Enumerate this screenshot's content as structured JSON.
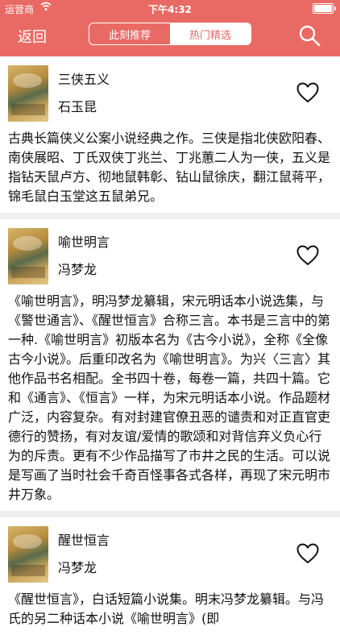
{
  "status_bar": {
    "carrier": "运营商",
    "time": "下午4:32"
  },
  "nav": {
    "back_label": "返回",
    "tabs": [
      {
        "label": "此刻推荐",
        "active": false
      },
      {
        "label": "热门精选",
        "active": true
      }
    ]
  },
  "books": [
    {
      "title": "三侠五义",
      "author": "石玉昆",
      "description": "古典长篇侠义公案小说经典之作。三侠是指北侠欧阳春、南侠展昭、丁氏双侠丁兆兰、丁兆蕙二人为一侠，五义是指钻天鼠卢方、彻地鼠韩彰、钻山鼠徐庆，翻江鼠蒋平，锦毛鼠白玉堂这五鼠弟兄。"
    },
    {
      "title": "喻世明言",
      "author": "冯梦龙",
      "description": "《喻世明言》，明冯梦龙纂辑，宋元明话本小说选集，与《警世通言》、《醒世恒言》合称三言。本书是三言中的第一种.《喻世明言》初版本名为《古今小说》，全称《全像古今小说》。后重印改名为《喻世明言》。为兴〈三言〉其他作品书名相配。全书四十卷，每卷一篇，共四十篇。它和《通言》、《恒言》一样，为宋元明话本小说。作品题材广泛，内容复杂。有对封建官僚丑恶的谴责和对正直官吏德行的赞扬，有对友谊/爱情的歌颂和对背信弃义负心行为的斥责。更有不少作品描写了市井之民的生活。可以说是写画了当时社会千奇百怪事各式各样，再现了宋元明市井万象。"
    },
    {
      "title": "醒世恒言",
      "author": "冯梦龙",
      "description": "《醒世恒言》，白话短篇小说集。明末冯梦龙纂辑。与冯氏的另二种话本小说《喻世明言》(即"
    }
  ],
  "colors": {
    "accent": "#e96a64",
    "separator": "#efefef"
  }
}
